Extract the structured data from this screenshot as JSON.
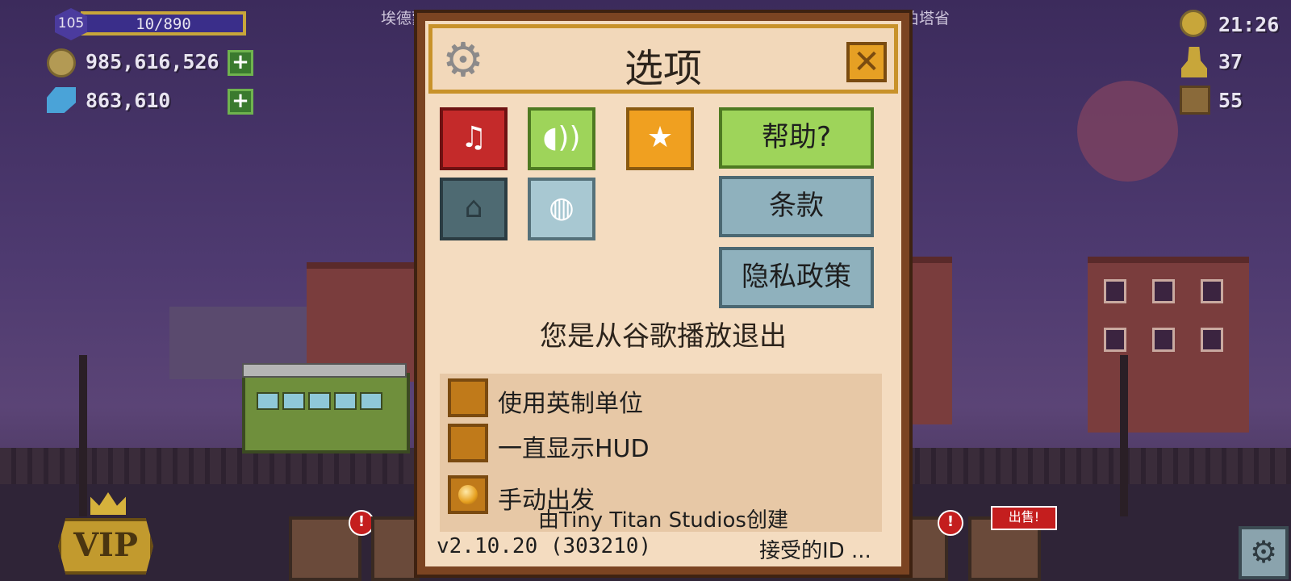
{
  "hud": {
    "level": "105",
    "xp": "10/890",
    "coins": "985,616,526",
    "gems": "863,610",
    "time": "21:26",
    "population": "37",
    "crates": "55",
    "location_left": "埃德蒙顿",
    "location_right": "伯塔省"
  },
  "bottom_bar": {
    "vip_label": "VIP",
    "sell_badge": "出售!",
    "alert_mark": "!"
  },
  "dialog": {
    "title": "选项",
    "icons": {
      "music": "music-off-icon",
      "sound": "sound-icon",
      "rate": "star-icon",
      "games": "game-controller-icon",
      "language": "chat-globe-icon",
      "settings": "gear-icon",
      "close": "close-icon"
    },
    "help_label": "帮助?",
    "terms_label": "条款",
    "privacy_label": "隐私政策",
    "status_message": "您是从谷歌播放退出",
    "options": [
      {
        "label": "使用英制单位",
        "checked": false
      },
      {
        "label": "一直显示HUD",
        "checked": false
      },
      {
        "label": "手动出发",
        "checked": true
      }
    ],
    "credit": "由Tiny Titan Studios创建",
    "version": "v2.10.20 (303210)",
    "accepted_ids": "接受的ID ..."
  },
  "colors": {
    "dialog_bg": "#f4dcc0",
    "dialog_border": "#7b4422",
    "music_red": "#c42a2a",
    "sound_green": "#9ed45a",
    "star_orange": "#f0a020",
    "help_green": "#9ed45a",
    "link_blue": "#8fb1bd"
  }
}
